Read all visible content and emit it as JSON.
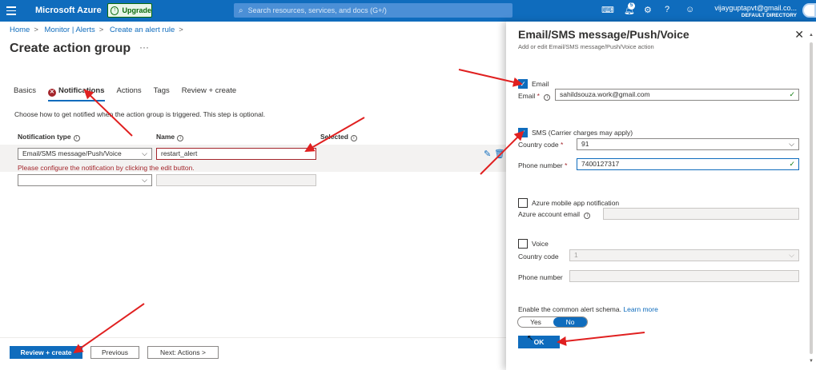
{
  "topbar": {
    "brand": "Microsoft Azure",
    "upgrade": "Upgrade",
    "search_placeholder": "Search resources, services, and docs (G+/)",
    "notif_count": "5",
    "user_email": "vijayguptapvt@gmail.co...",
    "user_directory": "DEFAULT DIRECTORY",
    "icons": [
      "hamburger-icon",
      "terminal-icon",
      "bell-icon",
      "gear-icon",
      "help-icon",
      "feedback-icon"
    ]
  },
  "breadcrumb": [
    "Home",
    "Monitor | Alerts",
    "Create an alert rule"
  ],
  "page_title": "Create action group",
  "tabs": [
    "Basics",
    "Notifications",
    "Actions",
    "Tags",
    "Review + create"
  ],
  "description": "Choose how to get notified when the action group is triggered. This step is optional.",
  "table": {
    "headers": [
      "Notification type",
      "Name",
      "Selected"
    ],
    "row1": {
      "type": "Email/SMS message/Push/Voice",
      "name": "restart_alert"
    },
    "error": "Please configure the notification by clicking the edit button."
  },
  "footer": {
    "review_create": "Review + create",
    "previous": "Previous",
    "next": "Next: Actions >"
  },
  "panel": {
    "title": "Email/SMS message/Push/Voice",
    "subtitle": "Add or edit Email/SMS message/Push/Voice action",
    "email_cb": "Email",
    "email_label": "Email",
    "email_value": "sahildsouza.work@gmail.com",
    "sms_cb": "SMS (Carrier charges may apply)",
    "country_code_label": "Country code",
    "country_code_value": "91",
    "phone_label": "Phone number",
    "phone_value": "7400127317",
    "azure_app_cb": "Azure mobile app notification",
    "azure_email_label": "Azure account email",
    "voice_cb": "Voice",
    "voice_country_label": "Country code",
    "voice_country_value": "1",
    "voice_phone_label": "Phone number",
    "schema_label": "Enable the common alert schema.",
    "learn_more": "Learn more",
    "yes": "Yes",
    "no": "No",
    "ok": "OK"
  },
  "colors": {
    "azure_blue": "#0f6cbd",
    "error_red": "#a4262c",
    "success_green": "#107c10",
    "annotation_red": "#e02020"
  }
}
